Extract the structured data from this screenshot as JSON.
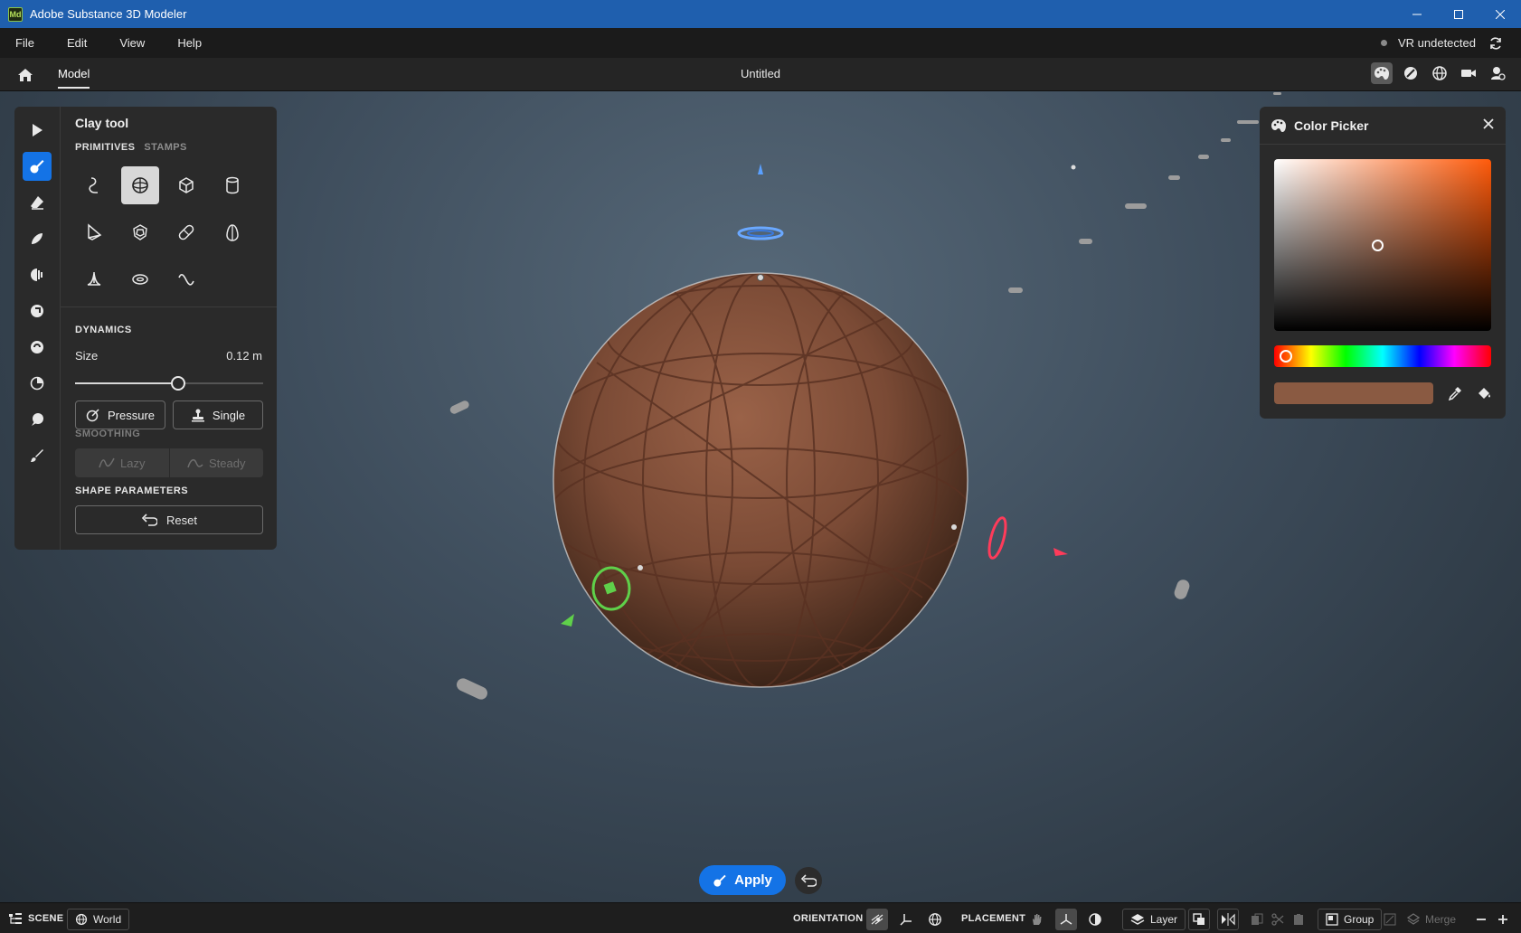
{
  "app": {
    "title": "Adobe Substance 3D Modeler",
    "logo": "Md"
  },
  "menu": {
    "items": [
      "File",
      "Edit",
      "View",
      "Help"
    ],
    "vr_status": "VR undetected"
  },
  "tabbar": {
    "tab": "Model",
    "document": "Untitled"
  },
  "clay_panel": {
    "title": "Clay tool",
    "tabs": {
      "primitives": "PRIMITIVES",
      "stamps": "STAMPS"
    },
    "primitives": [
      "curve",
      "sphere",
      "cube",
      "cylinder",
      "wedge",
      "dodecahedron",
      "capsule",
      "egg",
      "cone",
      "torus",
      "wave"
    ],
    "active_primitive": "sphere",
    "dynamics_label": "DYNAMICS",
    "size_label": "Size",
    "size_value": "0.12 m",
    "size_slider_fraction": 0.55,
    "pressure_label": "Pressure",
    "single_label": "Single",
    "smoothing_label": "SMOOTHING",
    "lazy_label": "Lazy",
    "steady_label": "Steady",
    "shape_params_label": "SHAPE PARAMETERS",
    "reset_label": "Reset"
  },
  "color_picker": {
    "title": "Color Picker",
    "hue_color": "#ff5a0a",
    "selected_color": "#8a5a42"
  },
  "viewport": {
    "apply_label": "Apply",
    "sphere_color": "#7a4a35"
  },
  "statusbar": {
    "scene_label": "SCENE",
    "world_label": "World",
    "orientation_label": "ORIENTATION",
    "placement_label": "PLACEMENT",
    "layer_label": "Layer",
    "group_label": "Group",
    "merge_label": "Merge"
  },
  "colors": {
    "accent": "#1473e6",
    "titlebar": "#1f5fae"
  }
}
